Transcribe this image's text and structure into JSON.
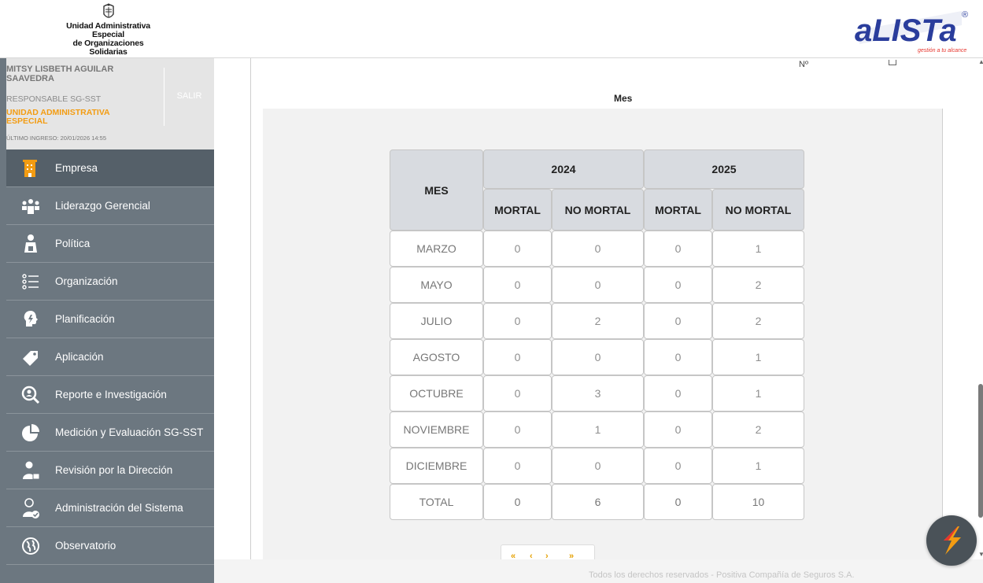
{
  "header": {
    "org_name_line1": "Unidad Administrativa Especial",
    "org_name_line2": "de Organizaciones Solidarias",
    "brand": "aLISTa",
    "brand_registered": "®",
    "brand_tagline": "gestión a tu alcance"
  },
  "user": {
    "name": "MITSY LISBETH AGUILAR SAAVEDRA",
    "role": "RESPONSABLE SG-SST",
    "organization": "UNIDAD ADMINISTRATIVA ESPECIAL",
    "last_login": "ÚLTIMO INGRESO: 20/01/2026 14:55",
    "logout_label": "SALIR"
  },
  "menu": [
    {
      "label": "Empresa",
      "icon": "building-icon",
      "active": true
    },
    {
      "label": "Liderazgo Gerencial",
      "icon": "team-leader-icon",
      "active": false
    },
    {
      "label": "Política",
      "icon": "speaker-person-icon",
      "active": false
    },
    {
      "label": "Organización",
      "icon": "list-icon",
      "active": false
    },
    {
      "label": "Planificación",
      "icon": "head-bolt-icon",
      "active": false
    },
    {
      "label": "Aplicación",
      "icon": "tag-icon",
      "active": false
    },
    {
      "label": "Reporte e Investigación",
      "icon": "magnifier-person-icon",
      "active": false
    },
    {
      "label": "Medición y Evaluación SG-SST",
      "icon": "pie-chart-icon",
      "active": false
    },
    {
      "label": "Revisión por la Dirección",
      "icon": "manager-icon",
      "active": false
    },
    {
      "label": "Administración del Sistema",
      "icon": "admin-user-icon",
      "active": false
    },
    {
      "label": "Observatorio",
      "icon": "globe-icon",
      "active": false
    }
  ],
  "chart_fragment": {
    "x_axis_title": "Mes",
    "partial_label": "Nº"
  },
  "table": {
    "month_header": "MES",
    "years": [
      "2024",
      "2025"
    ],
    "subheaders": [
      "MORTAL",
      "NO MORTAL",
      "MORTAL",
      "NO MORTAL"
    ],
    "rows": [
      {
        "mes": "MARZO",
        "v": [
          "0",
          "0",
          "0",
          "1"
        ]
      },
      {
        "mes": "MAYO",
        "v": [
          "0",
          "0",
          "0",
          "2"
        ]
      },
      {
        "mes": "JULIO",
        "v": [
          "0",
          "2",
          "0",
          "2"
        ]
      },
      {
        "mes": "AGOSTO",
        "v": [
          "0",
          "0",
          "0",
          "1"
        ]
      },
      {
        "mes": "OCTUBRE",
        "v": [
          "0",
          "3",
          "0",
          "1"
        ]
      },
      {
        "mes": "NOVIEMBRE",
        "v": [
          "0",
          "1",
          "0",
          "2"
        ]
      },
      {
        "mes": "DICIEMBRE",
        "v": [
          "0",
          "0",
          "0",
          "1"
        ]
      }
    ],
    "total": {
      "mes": "TOTAL",
      "v": [
        "0",
        "6",
        "0",
        "10"
      ]
    }
  },
  "pager": {
    "first": "«",
    "prev": "‹",
    "next": "›",
    "last": "»"
  },
  "footer": {
    "text": "Todos los derechos reservados - Positiva Compañía de Seguros S.A."
  },
  "colors": {
    "sidebar": "#6c7780",
    "active": "#556069",
    "accent": "#f39c12",
    "brand_blue": "#2a3d9c",
    "brand_red": "#e6362e"
  }
}
